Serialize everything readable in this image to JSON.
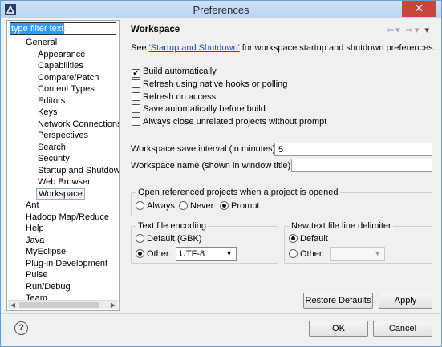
{
  "window": {
    "title": "Preferences",
    "close_glyph": "✕",
    "app_icon": "eclipse-icon"
  },
  "filter": {
    "value": "type filter text"
  },
  "tree": [
    {
      "label": "General",
      "level": 0
    },
    {
      "label": "Appearance",
      "level": 1
    },
    {
      "label": "Capabilities",
      "level": 1
    },
    {
      "label": "Compare/Patch",
      "level": 1
    },
    {
      "label": "Content Types",
      "level": 1
    },
    {
      "label": "Editors",
      "level": 1
    },
    {
      "label": "Keys",
      "level": 1
    },
    {
      "label": "Network Connections",
      "level": 1
    },
    {
      "label": "Perspectives",
      "level": 1
    },
    {
      "label": "Search",
      "level": 1
    },
    {
      "label": "Security",
      "level": 1
    },
    {
      "label": "Startup and Shutdown",
      "level": 1
    },
    {
      "label": "Web Browser",
      "level": 1
    },
    {
      "label": "Workspace",
      "level": 1,
      "selected": true
    },
    {
      "label": "Ant",
      "level": 0
    },
    {
      "label": "Hadoop Map/Reduce",
      "level": 0
    },
    {
      "label": "Help",
      "level": 0
    },
    {
      "label": "Java",
      "level": 0
    },
    {
      "label": "MyEclipse",
      "level": 0
    },
    {
      "label": "Plug-in Development",
      "level": 0
    },
    {
      "label": "Pulse",
      "level": 0
    },
    {
      "label": "Run/Debug",
      "level": 0
    },
    {
      "label": "Team",
      "level": 0
    }
  ],
  "page": {
    "title": "Workspace",
    "desc_prefix": "See ",
    "desc_link": "'Startup and Shutdown'",
    "desc_suffix": " for workspace startup and shutdown preferences.",
    "checkboxes": [
      {
        "label": "Build automatically",
        "checked": true
      },
      {
        "label": "Refresh using native hooks or polling",
        "checked": false
      },
      {
        "label": "Refresh on access",
        "checked": false
      },
      {
        "label": "Save automatically before build",
        "checked": false
      },
      {
        "label": "Always close unrelated projects without prompt",
        "checked": false
      }
    ],
    "save_interval_label": "Workspace save interval (in minutes):",
    "save_interval_value": "5",
    "ws_name_label": "Workspace name (shown in window title):",
    "ws_name_value": "",
    "open_ref": {
      "title": "Open referenced projects when a project is opened",
      "options": [
        "Always",
        "Never",
        "Prompt"
      ],
      "selected": "Prompt"
    },
    "encoding": {
      "title": "Text file encoding",
      "default_label": "Default (GBK)",
      "other_label": "Other:",
      "other_value": "UTF-8",
      "selected": "Other"
    },
    "delimiter": {
      "title": "New text file line delimiter",
      "default_label": "Default",
      "other_label": "Other:",
      "other_value": "",
      "selected": "Default"
    },
    "restore_label": "Restore Defaults",
    "apply_label": "Apply"
  },
  "footer": {
    "help_glyph": "?",
    "ok_label": "OK",
    "cancel_label": "Cancel"
  }
}
